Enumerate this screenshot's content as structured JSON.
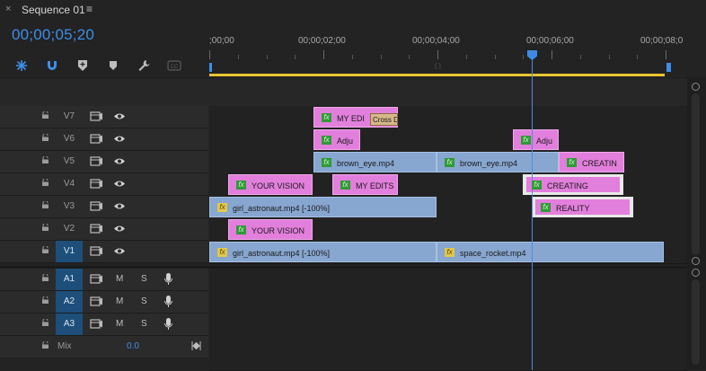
{
  "panel": {
    "close": "×",
    "title": "Sequence 01",
    "menu": "≡"
  },
  "timecode": "00;00;05;20",
  "toolbar": {
    "icons": [
      "snap-icon",
      "magnet-icon",
      "marker-add-icon",
      "marker-icon",
      "wrench-icon",
      "captions-icon"
    ]
  },
  "ruler": {
    "labels": [
      ";00;00",
      "00;00;02;00",
      "00;00;04;00",
      "00;00;06;00",
      "00;00;08;0"
    ],
    "center_label": "⟦⟧"
  },
  "video_tracks": [
    {
      "name": "V7",
      "active": false
    },
    {
      "name": "V6",
      "active": false
    },
    {
      "name": "V5",
      "active": false
    },
    {
      "name": "V4",
      "active": false
    },
    {
      "name": "V3",
      "active": false
    },
    {
      "name": "V2",
      "active": false
    },
    {
      "name": "V1",
      "active": true
    }
  ],
  "audio_tracks": [
    {
      "name": "A1",
      "m": "M",
      "s": "S"
    },
    {
      "name": "A2",
      "m": "M",
      "s": "S"
    },
    {
      "name": "A3",
      "m": "M",
      "s": "S"
    }
  ],
  "mix": {
    "label": "Mix",
    "value": "0.0"
  },
  "clips": {
    "v7_my_edi": "MY EDI",
    "v7_transition": "Cross D",
    "v6_adju_1": "Adju",
    "v6_adju_2": "Adju",
    "v5_brown_1": "brown_eye.mp4",
    "v5_brown_2": "brown_eye.mp4",
    "v5_creatin": "CREATIN",
    "v4_your_vision": "YOUR VISION",
    "v4_my_edits": "MY EDITS",
    "v4_creating": "CREATING",
    "v3_girl": "girl_astronaut.mp4 [-100%]",
    "v3_reality": "REALITY",
    "v2_your_vision": "YOUR VISION",
    "v1_girl": "girl_astronaut.mp4 [-100%]",
    "v1_space": "space_rocket.mp4"
  },
  "fx_label": "fx",
  "colors": {
    "accent": "#3e8ee8",
    "clip_pink": "#e27fdc",
    "clip_blue": "#87a6d0",
    "work_area": "#e8c430"
  }
}
